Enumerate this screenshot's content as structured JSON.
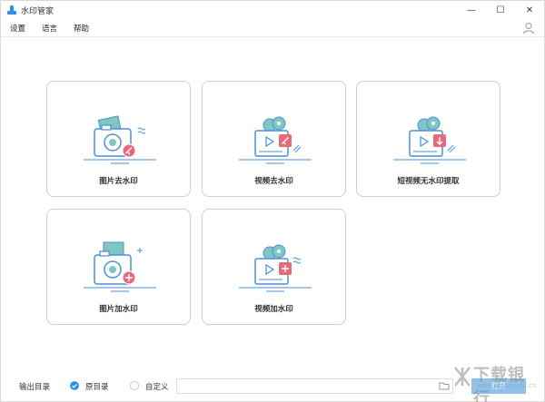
{
  "window": {
    "title": "水印管家",
    "controls": {
      "minimize": "—",
      "maximize": "☐",
      "close": "✕"
    }
  },
  "menu": {
    "items": [
      "设置",
      "语言",
      "帮助"
    ]
  },
  "cards": [
    {
      "label": "图片去水印",
      "icon": "image-remove-watermark-icon"
    },
    {
      "label": "视频去水印",
      "icon": "video-remove-watermark-icon"
    },
    {
      "label": "短视频无水印提取",
      "icon": "short-video-extract-icon"
    },
    {
      "label": "图片加水印",
      "icon": "image-add-watermark-icon"
    },
    {
      "label": "视频加水印",
      "icon": "video-add-watermark-icon"
    }
  ],
  "bottom": {
    "output_label": "输出目录",
    "option_original": "原目录",
    "option_custom": "自定义",
    "path_value": "",
    "open_button": "打开"
  },
  "watermark": {
    "text": "下载银行",
    "sub": "www.downbank.cn"
  },
  "colors": {
    "accent": "#2f8fe8",
    "icon_blue": "#4a90d9",
    "icon_teal": "#7fc7c0",
    "icon_red": "#e86a78",
    "button_disabled": "#8fc1ec"
  }
}
